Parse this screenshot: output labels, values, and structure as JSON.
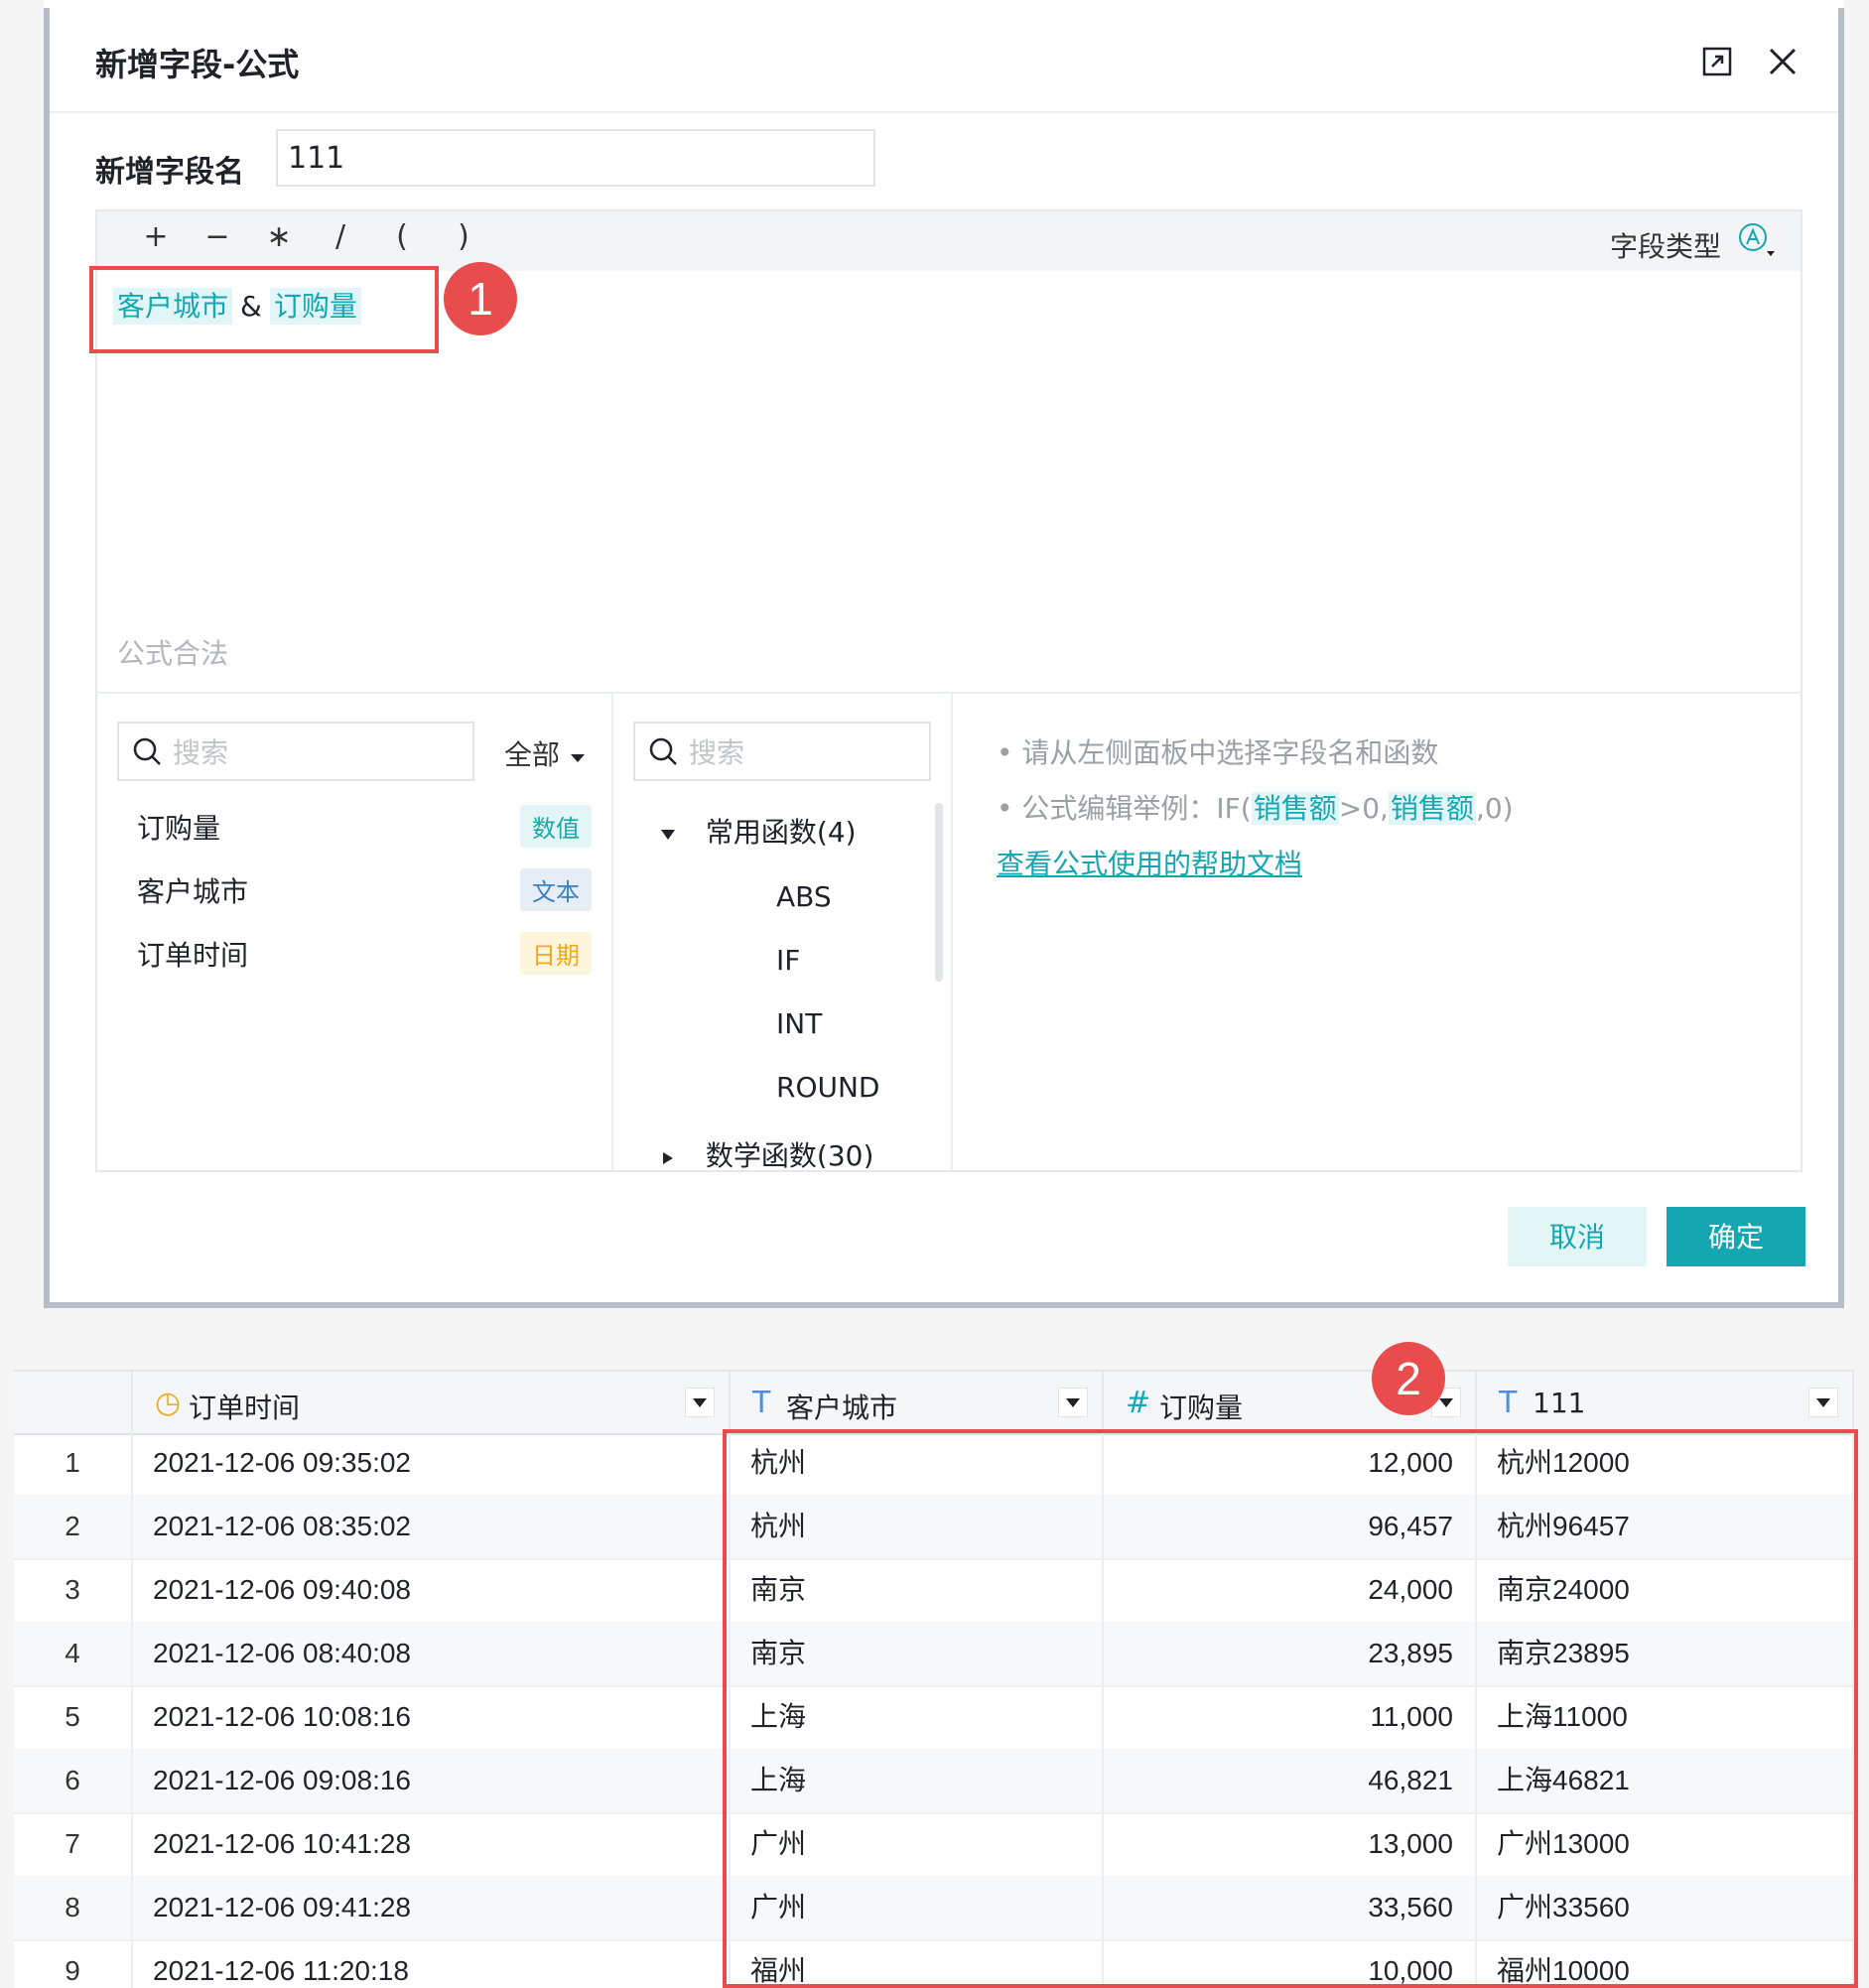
{
  "modal": {
    "title": "新增字段-公式",
    "field_name_label": "新增字段名",
    "field_name_value": "111",
    "operators": [
      "+",
      "−",
      "∗",
      "/",
      "(",
      ")"
    ],
    "field_type_label": "字段类型",
    "formula": {
      "token1": "客户城市",
      "op": "&",
      "token2": "订购量"
    },
    "status": "公式合法",
    "field_search_placeholder": "搜索",
    "scope_label": "全部",
    "fields": [
      {
        "name": "订购量",
        "type": "数值",
        "kind": "num"
      },
      {
        "name": "客户城市",
        "type": "文本",
        "kind": "text"
      },
      {
        "name": "订单时间",
        "type": "日期",
        "kind": "date"
      }
    ],
    "fn_search_placeholder": "搜索",
    "fn_groups": [
      {
        "label": "常用函数(4)",
        "items": [
          "ABS",
          "IF",
          "INT",
          "ROUND"
        ]
      },
      {
        "label": "数学函数(30)"
      }
    ],
    "help": {
      "line1": "• 请从左侧面板中选择字段名和函数",
      "line2_prefix": "• 公式编辑举例：IF(",
      "line2_field1": "销售额",
      "line2_mid": ">0,",
      "line2_field2": "销售额",
      "line2_suffix": ",0)",
      "link": "查看公式使用的帮助文档"
    },
    "cancel_label": "取消",
    "ok_label": "确定"
  },
  "callouts": {
    "one": "1",
    "two": "2"
  },
  "table": {
    "columns": [
      {
        "label": "订单时间",
        "icon": "◷"
      },
      {
        "label": "客户城市",
        "icon": "T"
      },
      {
        "label": "订购量",
        "icon": "#"
      },
      {
        "label": "111",
        "icon": "T"
      }
    ],
    "rows": [
      [
        "1",
        "2021-12-06 09:35:02",
        "杭州",
        "12,000",
        "杭州12000"
      ],
      [
        "2",
        "2021-12-06 08:35:02",
        "杭州",
        "96,457",
        "杭州96457"
      ],
      [
        "3",
        "2021-12-06 09:40:08",
        "南京",
        "24,000",
        "南京24000"
      ],
      [
        "4",
        "2021-12-06 08:40:08",
        "南京",
        "23,895",
        "南京23895"
      ],
      [
        "5",
        "2021-12-06 10:08:16",
        "上海",
        "11,000",
        "上海11000"
      ],
      [
        "6",
        "2021-12-06 09:08:16",
        "上海",
        "46,821",
        "上海46821"
      ],
      [
        "7",
        "2021-12-06 10:41:28",
        "广州",
        "13,000",
        "广州13000"
      ],
      [
        "8",
        "2021-12-06 09:41:28",
        "广州",
        "33,560",
        "广州33560"
      ],
      [
        "9",
        "2021-12-06 11:20:18",
        "福州",
        "10,000",
        "福州10000"
      ]
    ]
  },
  "colors": {
    "accent": "#14a7b1",
    "callout": "#e84c4c"
  }
}
